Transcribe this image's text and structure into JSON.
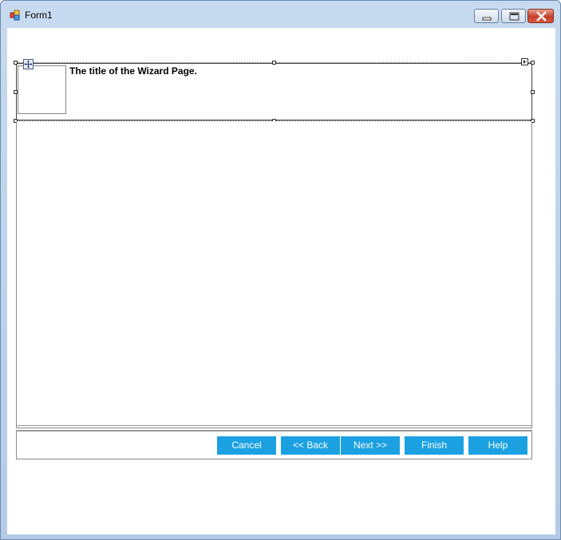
{
  "window": {
    "title": "Form1",
    "icon": "form-icon",
    "caption_buttons": [
      "minimize-icon",
      "maximize-icon",
      "close-icon"
    ]
  },
  "wizard": {
    "header_title": "The title of the Wizard Page.",
    "buttons": {
      "cancel": "Cancel",
      "back": "<< Back",
      "next": "Next >>",
      "finish": "Finish",
      "help": "Help"
    }
  },
  "colors": {
    "button_bg": "#1ba1e2",
    "button_text": "#ffffff"
  }
}
